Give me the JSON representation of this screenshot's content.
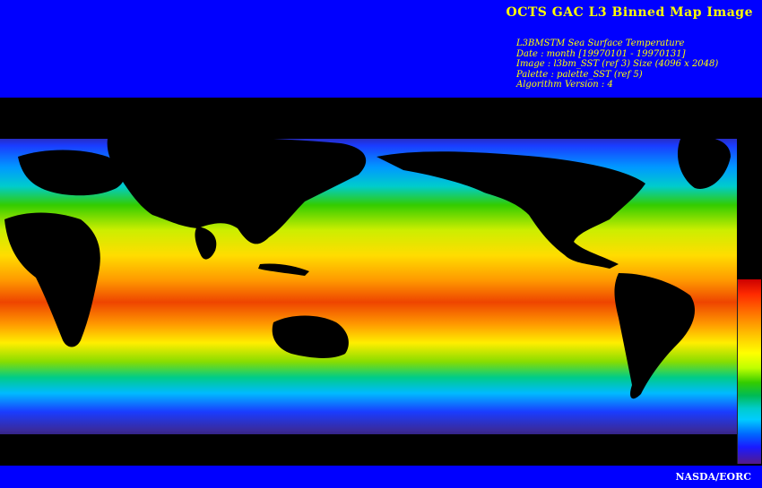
{
  "header": {
    "title": "OCTS GAC L3 Binned Map Image",
    "meta_lines": [
      "L3BMSTM Sea Surface Temperature",
      "Date : month [19970101 - 19970131]",
      "Image : l3bm_SST (ref 3) Size (4096 x 2048)",
      "Palette : palette_SST (ref 5)",
      "Algorithm Version : 4"
    ]
  },
  "map": {
    "type": "global sea surface temperature map",
    "projection": "equirectangular",
    "palette_colors": [
      "#cc0000",
      "#ff7f00",
      "#ffff00",
      "#33cc00",
      "#00cccc",
      "#0066ff",
      "#551a8b"
    ]
  },
  "footer": {
    "credit": "NASDA/EORC"
  }
}
